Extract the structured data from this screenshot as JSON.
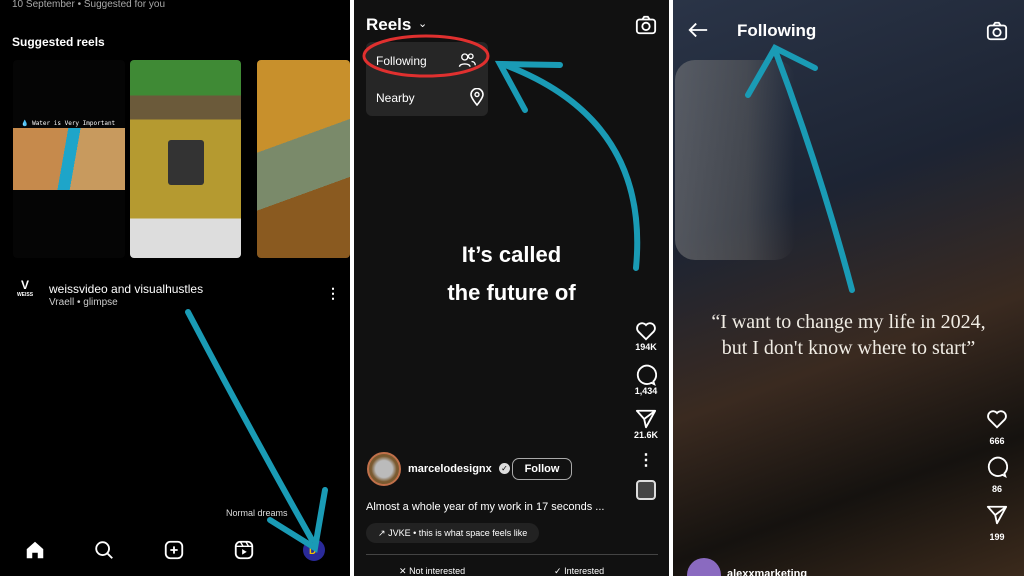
{
  "panel1": {
    "meta": "10 September • Suggested for you",
    "section_title": "Suggested reels",
    "thumb1_caption": "💧 Water is Very Important",
    "author_logo_text": "WEISS",
    "authors": "weissvideo and visualhustles",
    "audio": "Vraell • glimpse",
    "overlay_text": "Normal dreams",
    "nav": [
      "home-icon",
      "search-icon",
      "create-icon",
      "reels-icon",
      "profile-icon"
    ]
  },
  "panel2": {
    "title": "Reels",
    "menu": [
      {
        "label": "Following",
        "icon": "people-icon"
      },
      {
        "label": "Nearby",
        "icon": "location-pin-icon"
      }
    ],
    "overlay_line1": "It’s called",
    "overlay_line2": "the future of",
    "likes": "194K",
    "comments": "1,434",
    "shares": "21.6K",
    "username": "marcelodesignx",
    "follow_label": "Follow",
    "caption": "Almost a whole year of my work in 17 seconds ...",
    "audio": "JVKE • this is what space feels like",
    "not_interested": "Not interested",
    "interested": "Interested"
  },
  "panel3": {
    "title": "Following",
    "quote_line1": "“I want to change my life in 2024,",
    "quote_line2": "but I don't know where to start”",
    "likes": "666",
    "comments": "86",
    "shares": "199",
    "username": "alexxmarketing"
  },
  "colors": {
    "annotation_arrow": "#1a9bb5",
    "highlight_circle": "#e0302f"
  }
}
